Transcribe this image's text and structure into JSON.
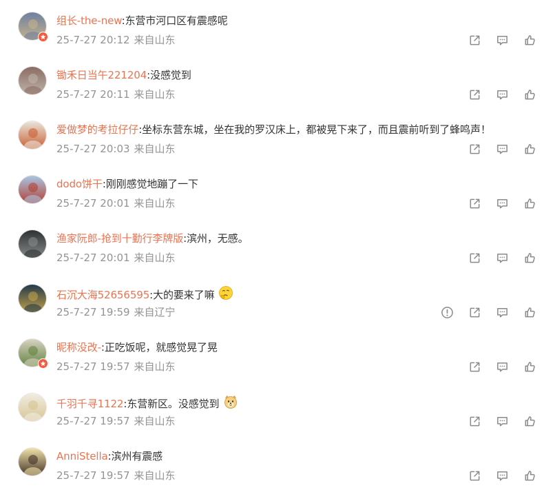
{
  "comments": [
    {
      "user": "组长-the-new",
      "text": ":东营市河口区有震感呢",
      "emoji": "",
      "date": "25-7-27",
      "time": "20:12",
      "location": "来自山东",
      "badge": true,
      "report": false,
      "avatar_colors": [
        "#6f7fa0",
        "#c9b58a"
      ]
    },
    {
      "user": "锄禾日当午221204",
      "text": ":没感觉到",
      "emoji": "",
      "date": "25-7-27",
      "time": "20:11",
      "location": "来自山东",
      "badge": false,
      "report": false,
      "avatar_colors": [
        "#8a6d63",
        "#c2b6ad"
      ]
    },
    {
      "user": "爱做梦的考拉仔仔",
      "text": ":坐标东营东城，坐在我的罗汉床上，都被晃下来了，而且震前听到了蜂鸣声！",
      "emoji": "",
      "date": "25-7-27",
      "time": "20:03",
      "location": "来自山东",
      "badge": false,
      "report": false,
      "avatar_colors": [
        "#e9e4dc",
        "#c85a2a"
      ]
    },
    {
      "user": "dodo饼干",
      "text": ":刚刚感觉地蹦了一下",
      "emoji": "",
      "date": "25-7-27",
      "time": "20:01",
      "location": "来自山东",
      "badge": false,
      "report": false,
      "avatar_colors": [
        "#aac6e4",
        "#b33a2a"
      ]
    },
    {
      "user": "渔家阮郎-抢到十勤行李牌版",
      "text": ":滨州，无感。",
      "emoji": "",
      "date": "25-7-27",
      "time": "20:01",
      "location": "来自山东",
      "badge": false,
      "report": false,
      "avatar_colors": [
        "#2f3232",
        "#8a8e8e"
      ]
    },
    {
      "user": "石沉大海52656595",
      "text": ":大的要来了嘛",
      "emoji": "thinking-emoji",
      "date": "25-7-27",
      "time": "19:59",
      "location": "来自辽宁",
      "badge": false,
      "report": true,
      "avatar_colors": [
        "#243a4a",
        "#c9a54a"
      ]
    },
    {
      "user": "昵称没改-",
      "text": ":正吃饭呢，就感觉晃了晃",
      "emoji": "",
      "date": "25-7-27",
      "time": "19:57",
      "location": "来自山东",
      "badge": true,
      "report": false,
      "avatar_colors": [
        "#d8d2c2",
        "#5d7f3a"
      ]
    },
    {
      "user": "千羽千寻1122",
      "text": ":东营新区。没感觉到",
      "emoji": "doge-emoji",
      "date": "25-7-27",
      "time": "19:57",
      "location": "来自山东",
      "badge": false,
      "report": false,
      "avatar_colors": [
        "#f1ece2",
        "#d6c38f"
      ]
    },
    {
      "user": "AnniStella",
      "text": ":滨州有震感",
      "emoji": "",
      "date": "25-7-27",
      "time": "19:57",
      "location": "来自山东",
      "badge": false,
      "report": false,
      "avatar_colors": [
        "#f3e2a8",
        "#3a2a22"
      ]
    }
  ],
  "colors": {
    "username": "#eb7350",
    "meta": "#939393",
    "badge": "#f55a3e",
    "icon": "#8a8a8a"
  }
}
